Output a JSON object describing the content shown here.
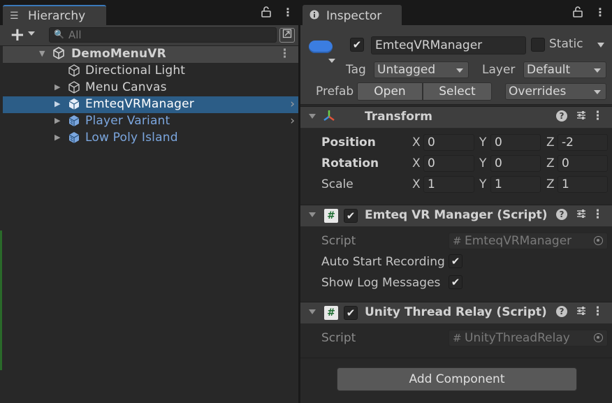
{
  "hierarchy": {
    "tab_label": "Hierarchy",
    "search_placeholder": "All",
    "items": [
      {
        "label": "DemoMenuVR"
      },
      {
        "label": "Directional Light"
      },
      {
        "label": "Menu Canvas"
      },
      {
        "label": "EmteqVRManager"
      },
      {
        "label": "Player Variant"
      },
      {
        "label": "Low Poly Island"
      }
    ]
  },
  "inspector": {
    "tab_label": "Inspector",
    "object_name": "EmteqVRManager",
    "active": true,
    "static_label": "Static",
    "static": false,
    "tag_label": "Tag",
    "tag_value": "Untagged",
    "layer_label": "Layer",
    "layer_value": "Default",
    "prefab_label": "Prefab",
    "prefab_open": "Open",
    "prefab_select": "Select",
    "prefab_overrides": "Overrides",
    "transform": {
      "title": "Transform",
      "position_label": "Position",
      "rotation_label": "Rotation",
      "scale_label": "Scale",
      "axis_x": "X",
      "axis_y": "Y",
      "axis_z": "Z",
      "position": {
        "x": "0",
        "y": "0",
        "z": "-2"
      },
      "rotation": {
        "x": "0",
        "y": "0",
        "z": "0"
      },
      "scale": {
        "x": "1",
        "y": "1",
        "z": "1"
      }
    },
    "emteq_script": {
      "title": "Emteq VR Manager (Script)",
      "script_label": "Script",
      "script_value": "EmteqVRManager",
      "auto_start_label": "Auto Start Recording",
      "auto_start": true,
      "show_log_label": "Show Log Messages",
      "show_log": true
    },
    "thread_relay": {
      "title": "Unity Thread Relay (Script)",
      "script_label": "Script",
      "script_value": "UnityThreadRelay"
    },
    "add_component_label": "Add Component"
  },
  "icons": {
    "check": "✔",
    "hash": "#",
    "help": "?"
  },
  "colors": {
    "selection": "#2c5d87",
    "prefab_text": "#7ba6de",
    "tab_accent": "#3a79bb",
    "gameobject_icon": "#3b7de0"
  }
}
